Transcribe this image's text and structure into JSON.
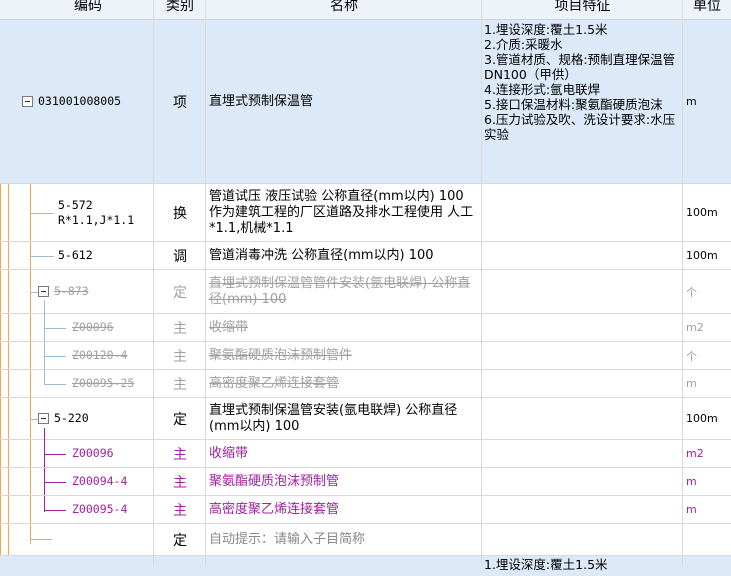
{
  "columns": {
    "code": "编码",
    "type": "类别",
    "name": "名称",
    "features": "项目特征",
    "unit": "单位"
  },
  "rows": [
    {
      "code": "031001008005",
      "type": "项",
      "name": "直埋式预制保温管",
      "features": [
        "1.埋设深度:覆土1.5米",
        "2.介质:采暖水",
        "3.管道材质、规格:预制直理保温管DN100（甲供）",
        "4.连接形式:氩电联焊",
        "5.接口保温材料:聚氨酯硬质泡沫",
        "6.压力试验及吹、洗设计要求:水压实验"
      ],
      "unit": "m"
    },
    {
      "code_line1": "5-572",
      "code_line2": "R*1.1,J*1.1",
      "type": "换",
      "name": "管道试压 液压试验 公称直径(mm以内) 100　作为建筑工程的厂区道路及排水工程使用 人工*1.1,机械*1.1",
      "unit": "100m"
    },
    {
      "code": "5-612",
      "type": "调",
      "name": "管道消毒冲洗 公称直径(mm以内) 100",
      "unit": "100m"
    },
    {
      "code": "5-873",
      "type": "定",
      "name": "直埋式预制保温管管件安装(氩电联焊) 公称直径(mm) 100",
      "unit": "个"
    },
    {
      "code": "Z00096",
      "type": "主",
      "name": "收缩带",
      "unit": "m2"
    },
    {
      "code": "Z00120-4",
      "type": "主",
      "name": "聚氨酯硬质泡沫预制管件",
      "unit": "个"
    },
    {
      "code": "Z00095-25",
      "type": "主",
      "name": "高密度聚乙烯连接套管",
      "unit": "m"
    },
    {
      "code": "5-220",
      "type": "定",
      "name": "直埋式预制保温管安装(氩电联焊) 公称直径(mm以内) 100",
      "unit": "100m"
    },
    {
      "code": "Z00096",
      "type": "主",
      "name": "收缩带",
      "unit": "m2"
    },
    {
      "code": "Z00094-4",
      "type": "主",
      "name": "聚氨酯硬质泡沫预制管",
      "unit": "m"
    },
    {
      "code": "Z00095-4",
      "type": "主",
      "name": "高密度聚乙烯连接套管",
      "unit": "m"
    },
    {
      "code": "",
      "type": "定",
      "name": "自动提示：请输入子目简称",
      "unit": ""
    },
    {
      "features_partial": "1.埋设深度:覆土1.5米"
    }
  ],
  "colors": {
    "selected_row": "#dce9f8",
    "disabled_text": "#a0a0a0",
    "main_material_text": "#a020a0",
    "tree_line": "#f0a94a"
  }
}
